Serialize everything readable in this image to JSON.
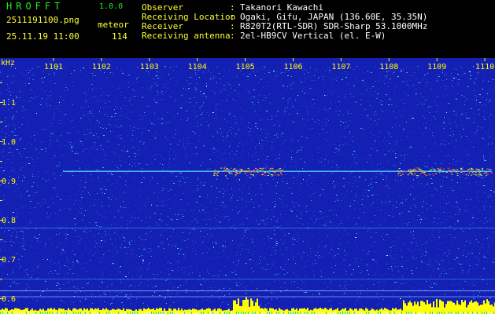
{
  "app": {
    "title": "HROFFT",
    "version": "1.0.0"
  },
  "file": {
    "name": "2511191100.png",
    "timestamp": "25.11.19 11:00"
  },
  "meteor": {
    "label": "meteor",
    "count": "114"
  },
  "info": [
    {
      "label": "Observer",
      "sep": ":",
      "value": "Takanori Kawachi"
    },
    {
      "label": "Receiving Location",
      "sep": ":",
      "value": "Ogaki, Gifu, JAPAN (136.60E, 35.35N)"
    },
    {
      "label": "Receiver",
      "sep": ":",
      "value": "R820T2(RTL-SDR) SDR-Sharp 53.1000MHz"
    },
    {
      "label": "Receiving antenna",
      "sep": ":",
      "value": "2el-HB9CV Vertical (el. E-W)"
    }
  ],
  "axis": {
    "y_unit": "kHz",
    "y_ticks": [
      "1.1",
      "1.0",
      "0.9",
      "0.8",
      "0.7",
      "0.6"
    ],
    "x_ticks": [
      "1101",
      "1102",
      "1103",
      "1104",
      "1105",
      "1106",
      "1107",
      "1108",
      "1109",
      "1110"
    ]
  },
  "colors": {
    "spectrogram_bg": "#1420b4",
    "noise": [
      "#1e3fd0",
      "#2a6ee0",
      "#2fa8e8",
      "#39d0f0",
      "#9ef0ff"
    ],
    "signal_hot": [
      "#ff2a2a",
      "#ff8a1a",
      "#ffe14a",
      "#8cff5a"
    ],
    "power_bar": "#ffff00",
    "tick_label": "#ffff00",
    "header_green": "#22ee22",
    "header_yellow": "#ffff33"
  }
}
